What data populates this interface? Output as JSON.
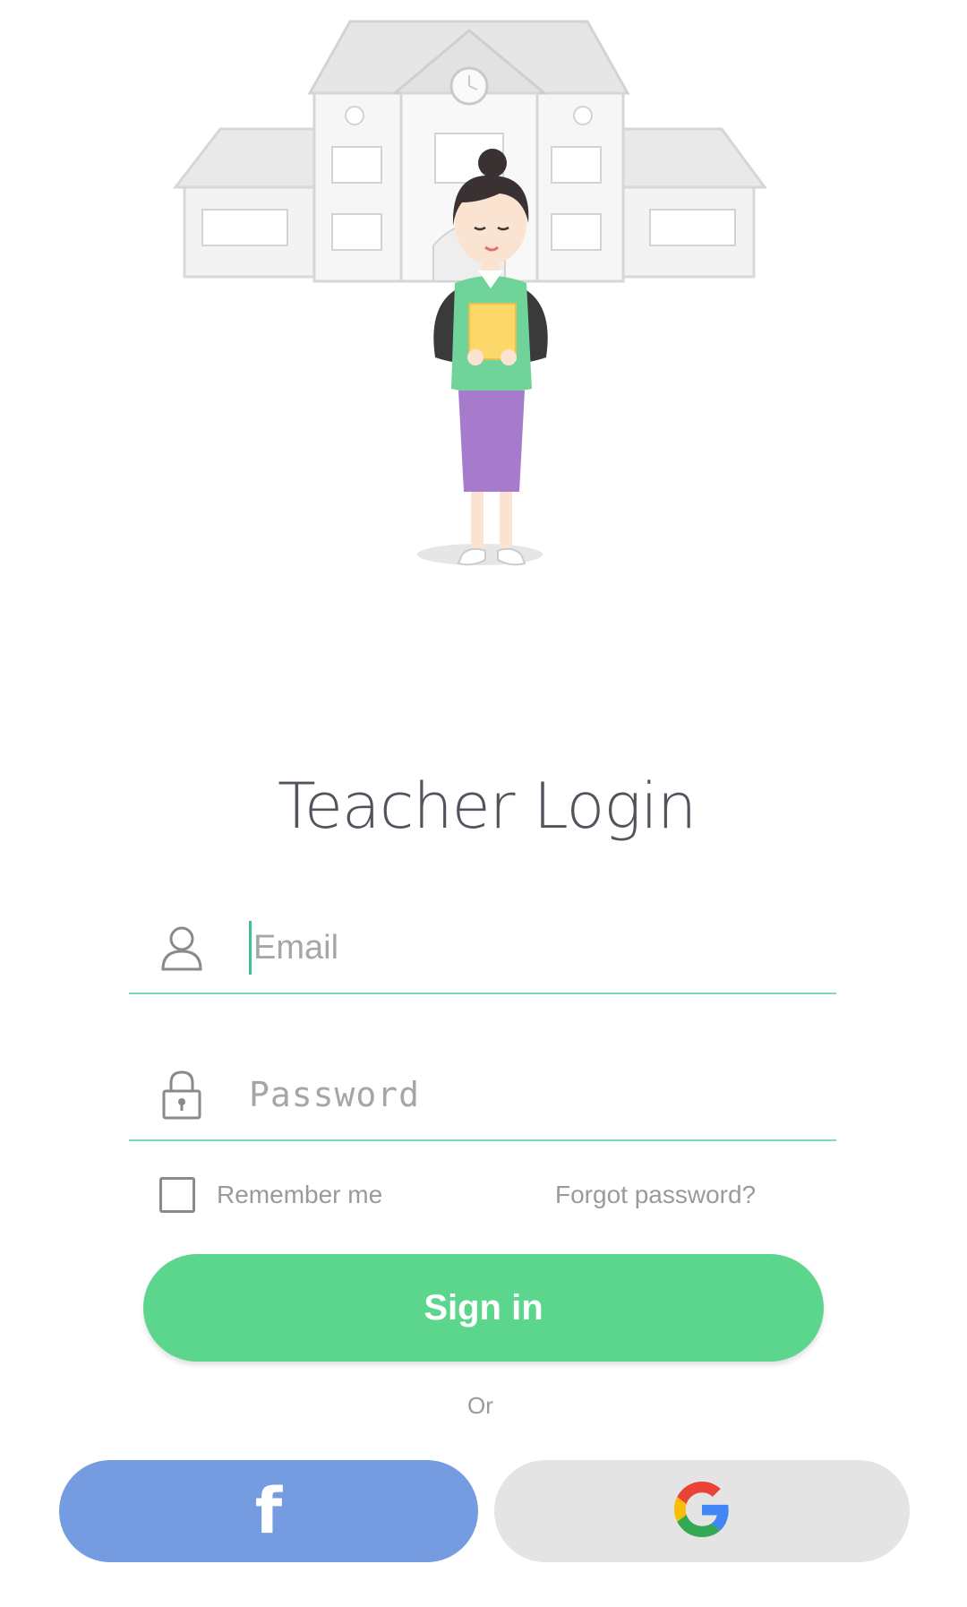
{
  "title": "Teacher Login",
  "email_field": {
    "placeholder": "Email",
    "icon": "person-icon"
  },
  "password_field": {
    "placeholder": "Password",
    "icon": "lock-icon"
  },
  "remember_label": "Remember me",
  "forgot_label": "Forgot password?",
  "signin_label": "Sign in",
  "or_label": "Or",
  "facebook_button": {
    "glyph": "f",
    "icon": "facebook-icon"
  },
  "google_button": {
    "icon": "google-icon"
  },
  "colors": {
    "primary_green": "#5cd68d",
    "facebook_blue": "#759be0",
    "google_grey": "#e4e4e4",
    "hint_grey": "#a6a6a6"
  }
}
